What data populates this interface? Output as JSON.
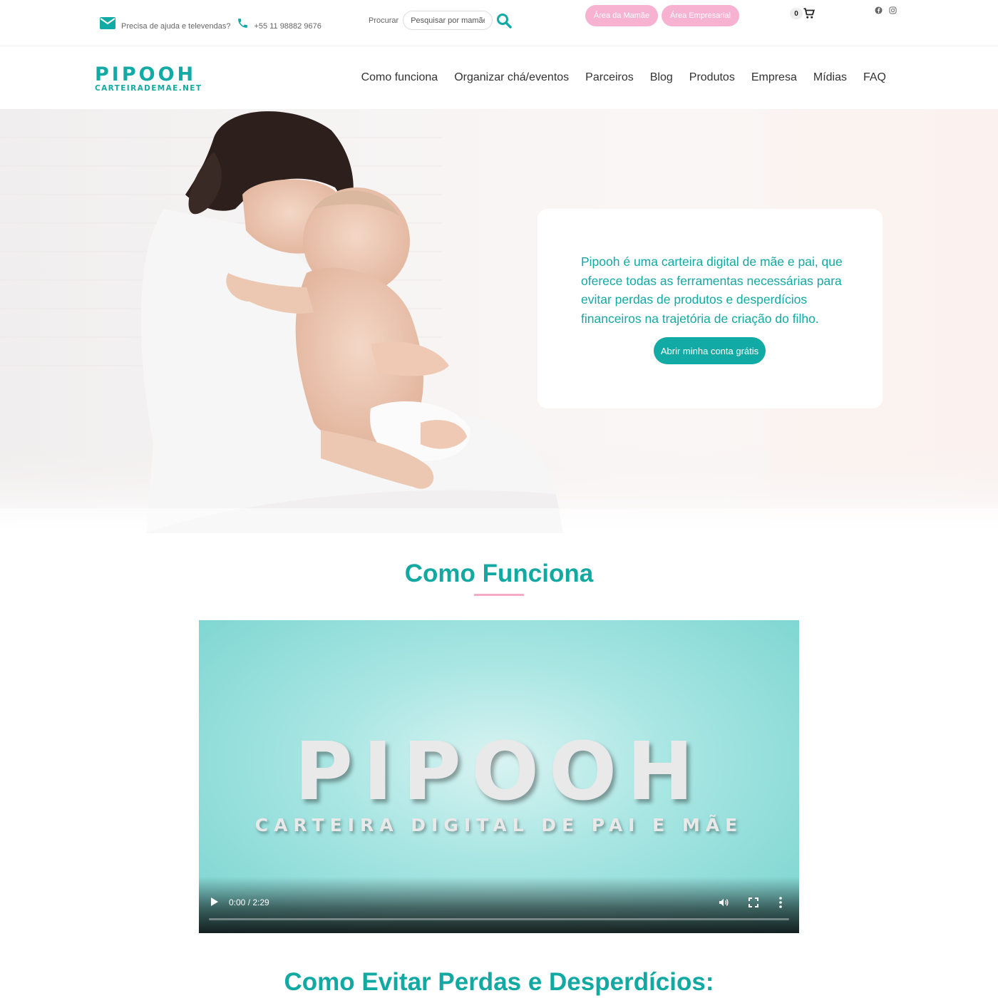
{
  "topbar": {
    "help_text": "Precisa de ajuda e televendas?",
    "phone": "+55 11 98882 9676",
    "search_label": "Procurar",
    "search_placeholder": "Pesquisar por mamãe/",
    "area_mamae": "Área da Mamãe",
    "area_empresarial": "Área Empresarial",
    "cart_count": "0",
    "icons": [
      "envelope-icon",
      "phone-icon",
      "search-icon",
      "cart-icon",
      "facebook-icon",
      "instagram-icon"
    ]
  },
  "brand": {
    "name": "PIPOOH",
    "domain": "CARTEIRADEMAE.NET",
    "accent": "#12aaa4",
    "pink": "#f7b2d1"
  },
  "nav": {
    "items": [
      "Como funciona",
      "Organizar chá/eventos",
      "Parceiros",
      "Blog",
      "Produtos",
      "Empresa",
      "Mídias",
      "FAQ"
    ]
  },
  "hero": {
    "description": "Pipooh é uma carteira digital de mãe e pai, que oferece todas as ferramentas necessárias para evitar perdas de produtos e desperdícios financeiros na trajetória de criação do filho.",
    "cta": "Abrir minha conta grátis"
  },
  "how_it_works": {
    "title": "Como Funciona",
    "video": {
      "title_word": "PIPOOH",
      "subtitle": "CARTEIRA DIGITAL DE PAI E MÃE",
      "time": "0:00 / 2:29",
      "progress": 0
    }
  },
  "next_section": {
    "title": "Como Evitar Perdas e Desperdícios:"
  }
}
